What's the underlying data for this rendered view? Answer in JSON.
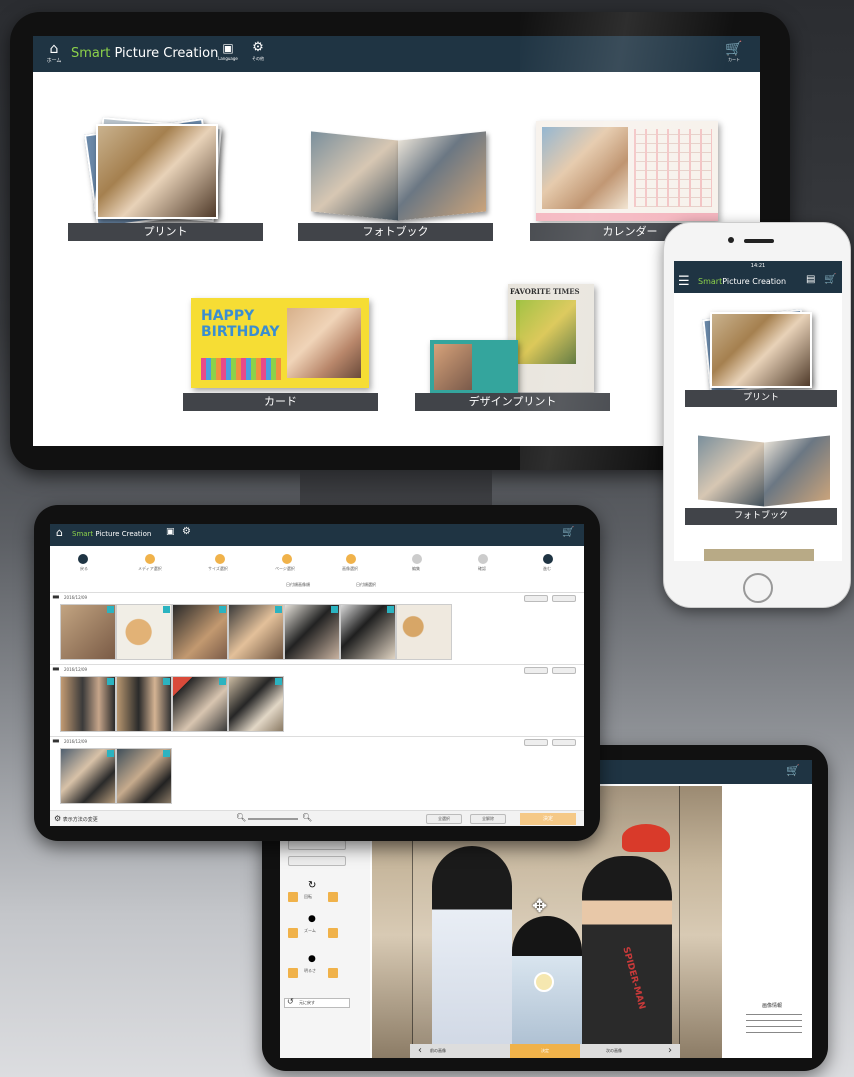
{
  "monitor": {
    "app_title_prefix": "Smart",
    "app_title_suffix": " Picture Creation",
    "home_label": "ホーム",
    "language_label": "Language",
    "other_label": "その他",
    "cart_label": "カート",
    "products": [
      {
        "label": "プリント"
      },
      {
        "label": "フォトブック"
      },
      {
        "label": "カレンダー"
      },
      {
        "label": "カード"
      },
      {
        "label": "デザインプリント"
      }
    ],
    "card_text": "HAPPY BIRTHDAY",
    "newspaper_text": "FAVORITE TIMES"
  },
  "phone": {
    "status_time": "14:21",
    "app_title_prefix": "Smart",
    "app_title_suffix": "Picture Creation",
    "products": [
      {
        "label": "プリント"
      },
      {
        "label": "フォトブック"
      }
    ]
  },
  "tablet1": {
    "app_title_prefix": "Smart",
    "app_title_suffix": " Picture Creation",
    "steps": [
      {
        "label": "戻る"
      },
      {
        "label": "メディア選択"
      },
      {
        "label": "サイズ選択"
      },
      {
        "label": "ページ選択"
      },
      {
        "label": "画像選択"
      },
      {
        "label": "編集"
      },
      {
        "label": "確認"
      },
      {
        "label": "進む"
      }
    ],
    "filter_a": "日付順画像順",
    "filter_b": "日付順選択",
    "folder_labels": [
      "2016/12/09",
      "2016/12/09",
      "2016/12/09"
    ],
    "settings_label": "表示方法の変更",
    "cancel_label": "全選択",
    "clear_label": "全解除",
    "ok_label": "決定"
  },
  "tablet2": {
    "rotate_label": "回転",
    "zoom_label": "ズーム",
    "bright_label": "明るさ",
    "reset_label": "元に戻す",
    "prev_label": "前の画像",
    "ok_label": "決定",
    "next_label": "次の画像",
    "info_title": "画像情報",
    "shirt_text": "SPIDER-MAN"
  },
  "colors": {
    "accent_green": "#8cd14a",
    "bar_navy": "#1f3443",
    "label_gray": "#414449",
    "orange": "#f0b24a"
  }
}
